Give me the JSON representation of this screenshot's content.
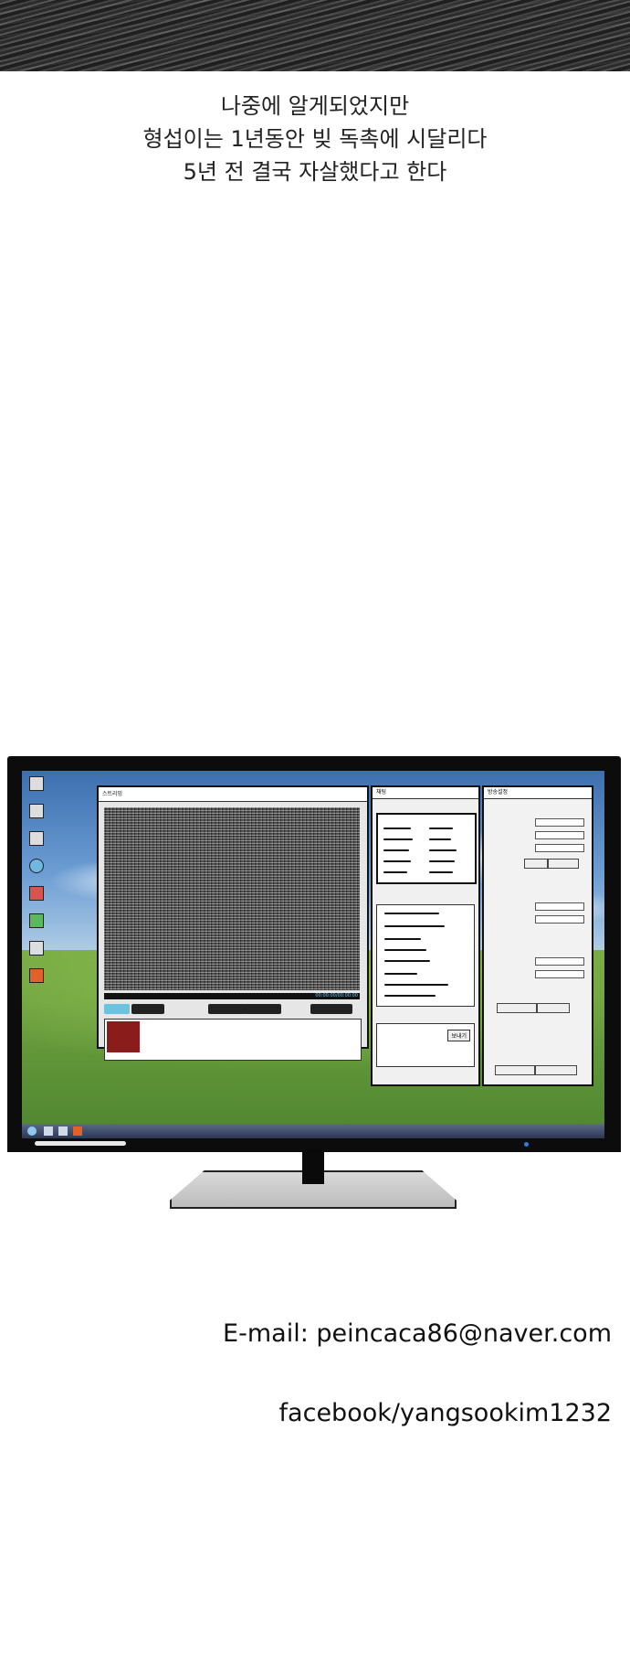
{
  "narration": {
    "line1": "나중에 알게되었지만",
    "line2": "형섭이는 1년동안 빚 독촉에 시달리다",
    "line3": "5년 전 결국 자살했다고 한다"
  },
  "contact": {
    "email": "E-mail: peincaca86@naver.com",
    "facebook": "facebook/yangsookim1232"
  },
  "screen": {
    "chat_send": "보내기",
    "settings_title": "방송설정",
    "main_app_title": "스트리밍",
    "chat_title": "채팅",
    "timer": "00:00:00/00:00:00"
  },
  "colors": {
    "monitor": "#0c0c0c",
    "text": "#222222"
  }
}
